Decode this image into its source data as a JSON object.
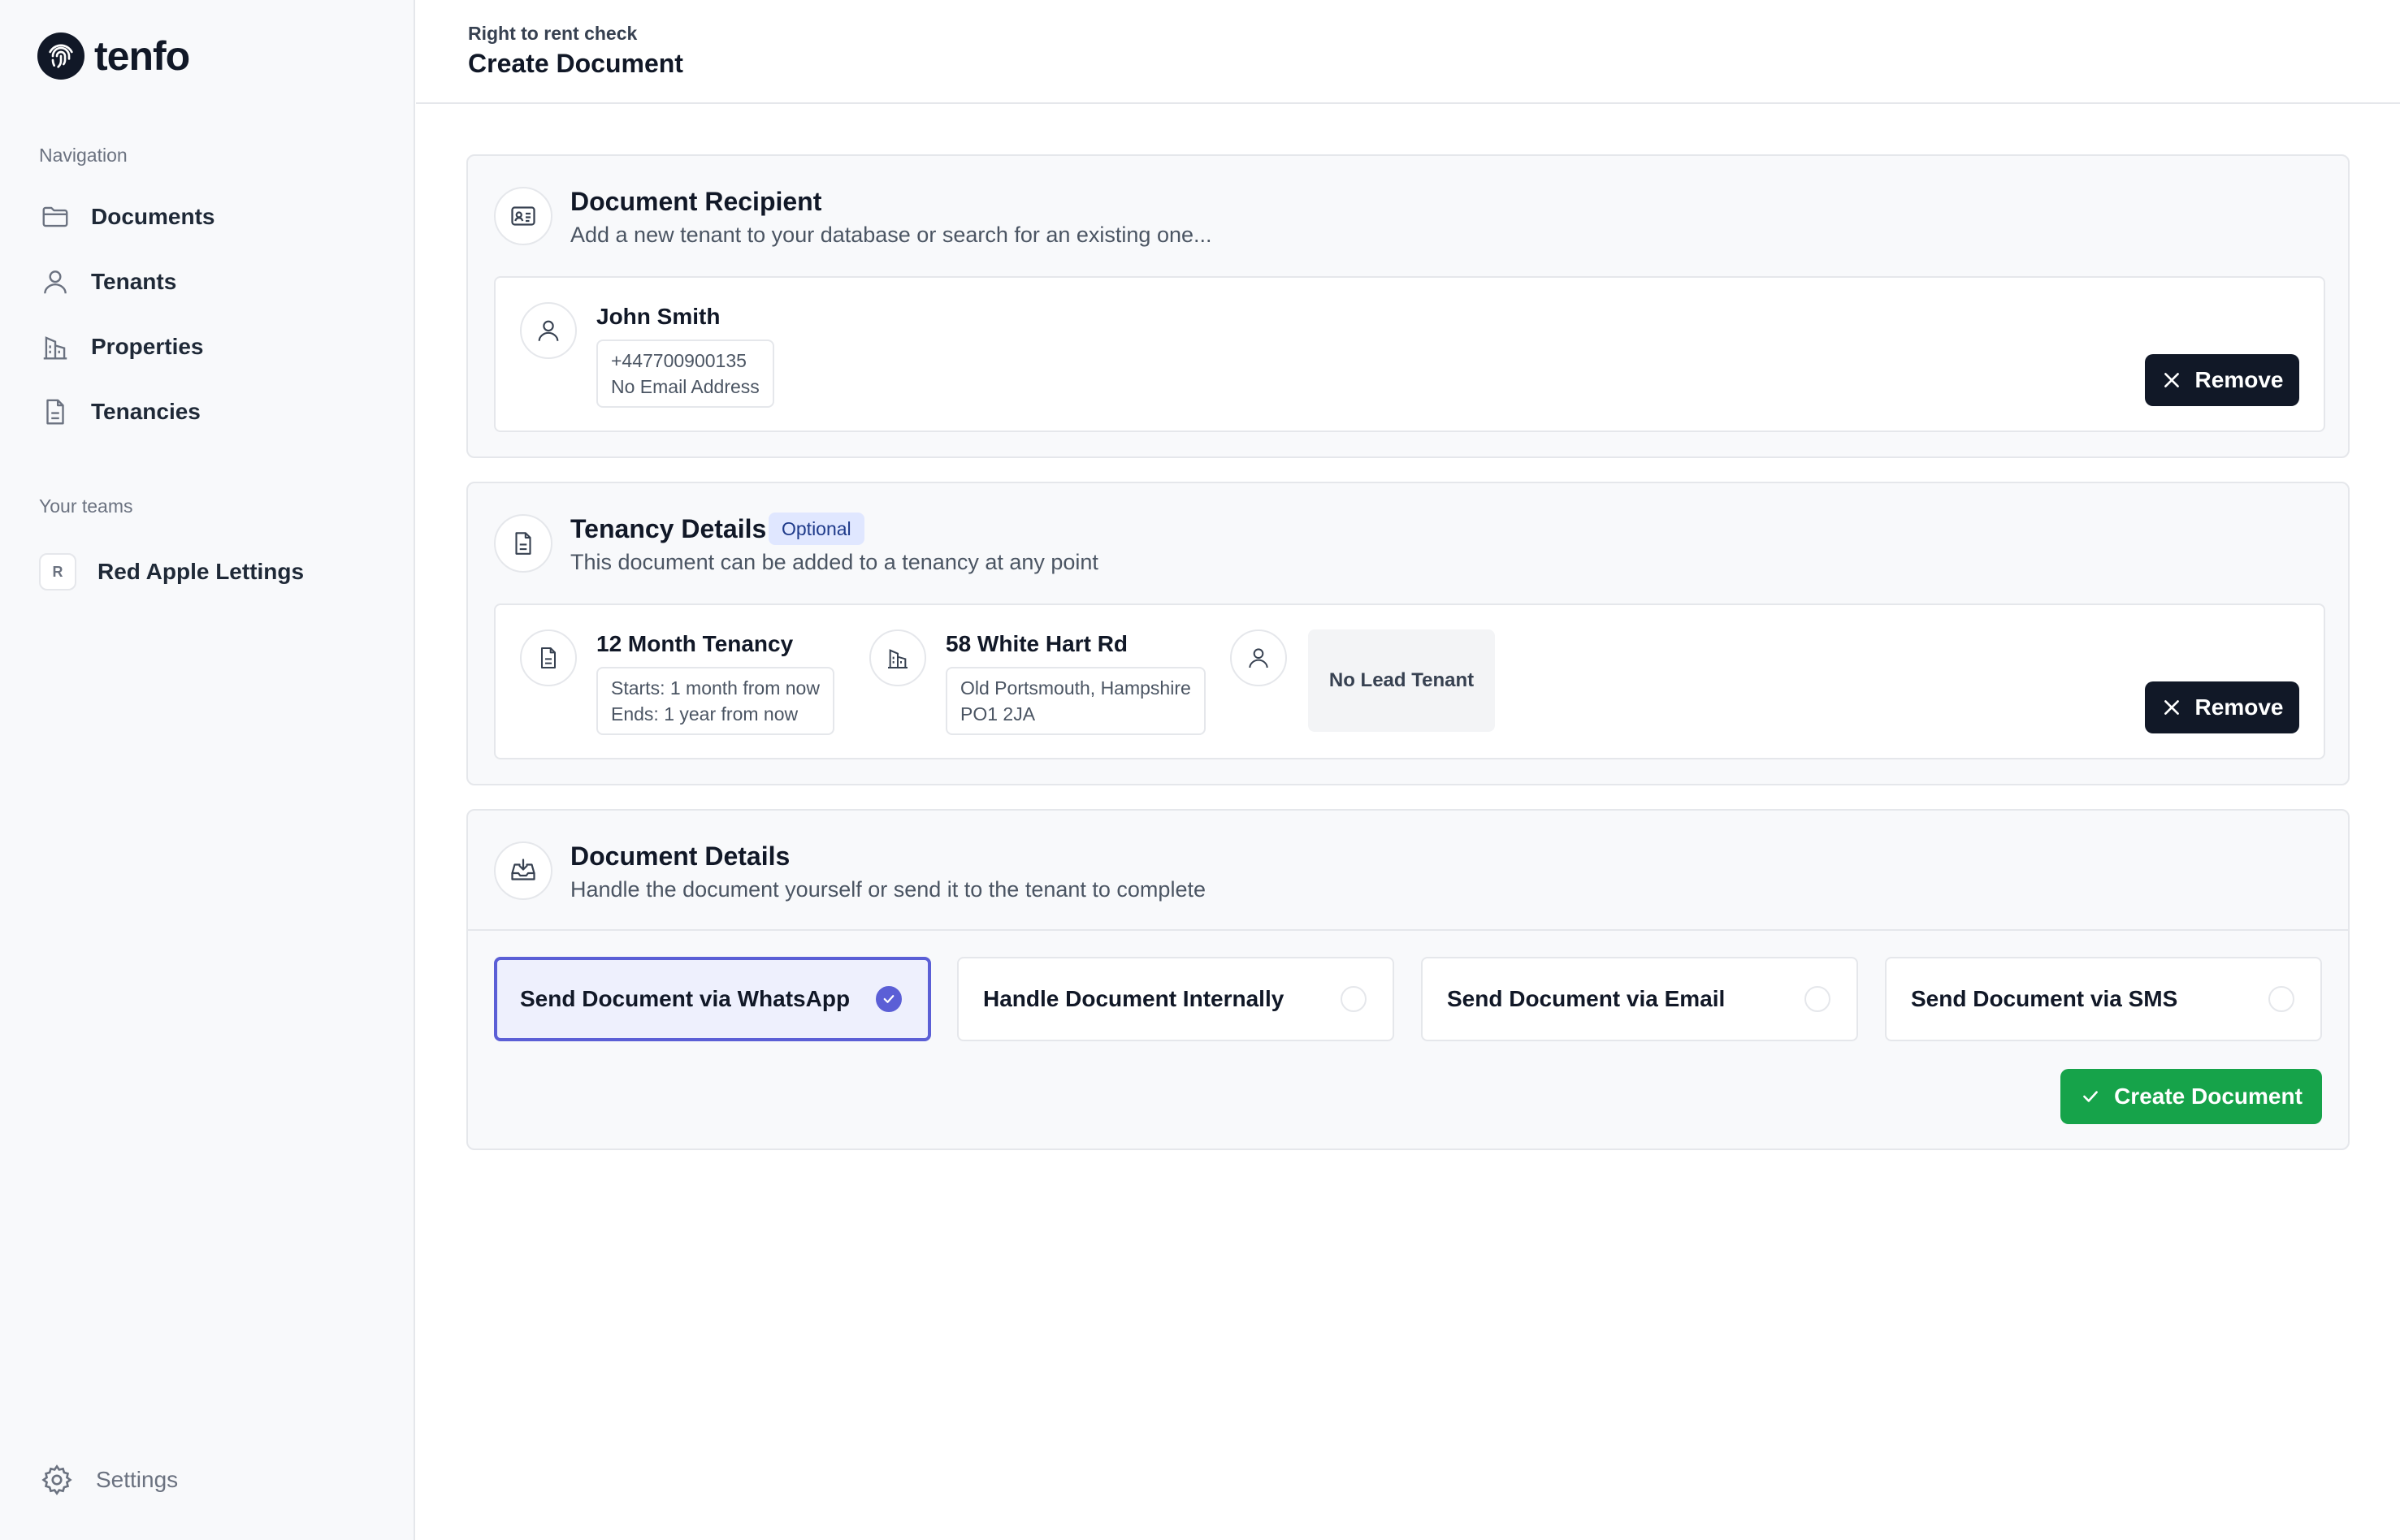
{
  "brand": {
    "name": "tenfo"
  },
  "sidebar": {
    "nav_label": "Navigation",
    "items": [
      {
        "label": "Documents",
        "icon": "folder-icon"
      },
      {
        "label": "Tenants",
        "icon": "user-icon"
      },
      {
        "label": "Properties",
        "icon": "building-icon"
      },
      {
        "label": "Tenancies",
        "icon": "document-icon"
      }
    ],
    "teams_label": "Your teams",
    "teams": [
      {
        "initial": "R",
        "name": "Red Apple Lettings"
      }
    ],
    "settings_label": "Settings"
  },
  "header": {
    "breadcrumb": "Right to rent check",
    "title": "Create Document"
  },
  "recipient": {
    "title": "Document Recipient",
    "subtitle": "Add a new tenant to your database or search for an existing one...",
    "tenant_name": "John Smith",
    "phone": "+447700900135",
    "email": "No Email Address",
    "remove_label": "Remove"
  },
  "tenancy": {
    "title": "Tenancy Details",
    "badge": "Optional",
    "subtitle": "This document can be added to a tenancy at any point",
    "tenancy_name": "12 Month Tenancy",
    "starts": "Starts: 1 month from now",
    "ends": "Ends: 1 year from now",
    "property_name": "58 White Hart Rd",
    "address_line1": "Old Portsmouth, Hampshire",
    "address_line2": "PO1 2JA",
    "lead_tenant": "No Lead Tenant",
    "remove_label": "Remove"
  },
  "details": {
    "title": "Document Details",
    "subtitle": "Handle the document yourself or send it to the tenant to complete",
    "options": [
      {
        "label": "Send Document via WhatsApp",
        "selected": true
      },
      {
        "label": "Handle Document Internally",
        "selected": false
      },
      {
        "label": "Send Document via Email",
        "selected": false
      },
      {
        "label": "Send Document via SMS",
        "selected": false
      }
    ],
    "create_label": "Create Document"
  },
  "colors": {
    "primary_dark": "#111827",
    "accent_indigo": "#5b5fd6",
    "success_green": "#16a34a",
    "badge_bg": "#e0e7ff"
  }
}
